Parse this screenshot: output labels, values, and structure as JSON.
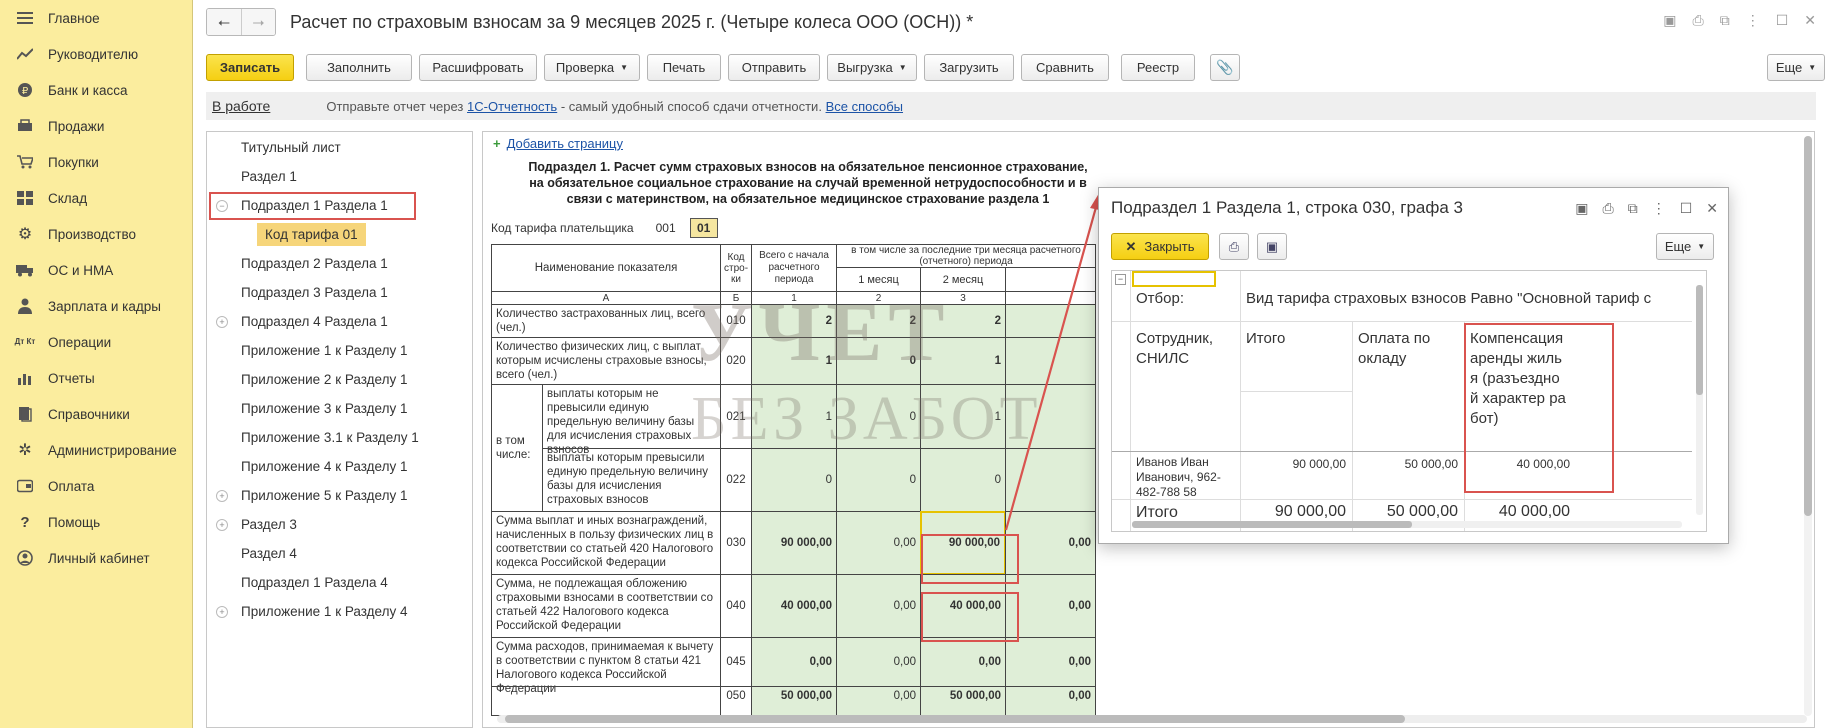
{
  "sidebar": {
    "items": [
      {
        "label": "Главное",
        "icon": "menu-icon"
      },
      {
        "label": "Руководителю",
        "icon": "trend-icon"
      },
      {
        "label": "Банк и касса",
        "icon": "ruble-icon"
      },
      {
        "label": "Продажи",
        "icon": "cart-icon"
      },
      {
        "label": "Покупки",
        "icon": "basket-icon"
      },
      {
        "label": "Склад",
        "icon": "warehouse-icon"
      },
      {
        "label": "Производство",
        "icon": "gear-icon"
      },
      {
        "label": "ОС и НМА",
        "icon": "truck-icon"
      },
      {
        "label": "Зарплата и кадры",
        "icon": "person-icon"
      },
      {
        "label": "Операции",
        "icon": "operations-icon",
        "glyph": "Дт Кт"
      },
      {
        "label": "Отчеты",
        "icon": "chart-icon"
      },
      {
        "label": "Справочники",
        "icon": "book-icon"
      },
      {
        "label": "Администрирование",
        "icon": "settings-icon"
      },
      {
        "label": "Оплата",
        "icon": "payment-icon"
      },
      {
        "label": "Помощь",
        "icon": "help-icon"
      },
      {
        "label": "Личный кабинет",
        "icon": "account-icon"
      }
    ]
  },
  "header": {
    "title": "Расчет по страховым взносам за 9 месяцев 2025 г. (Четыре колеса ООО (ОСН)) *"
  },
  "toolbar": {
    "write": "Записать",
    "fill": "Заполнить",
    "decode": "Расшифровать",
    "check": "Проверка",
    "print": "Печать",
    "send": "Отправить",
    "export": "Выгрузка",
    "load": "Загрузить",
    "compare": "Сравнить",
    "registry": "Реестр",
    "more": "Еще"
  },
  "infobar": {
    "status": "В работе",
    "text_before": "Отправьте отчет через",
    "link1": "1С-Отчетность",
    "text_middle": "- самый удобный способ сдачи отчетности.",
    "link2": "Все способы"
  },
  "tree": {
    "items": [
      {
        "label": "Титульный лист",
        "expander": ""
      },
      {
        "label": "Раздел 1",
        "expander": ""
      },
      {
        "label": "Подраздел 1 Раздела 1",
        "expander": "−"
      },
      {
        "label": "Код тарифа 01",
        "expander": ""
      },
      {
        "label": "Подраздел 2 Раздела 1",
        "expander": ""
      },
      {
        "label": "Подраздел 3 Раздела 1",
        "expander": ""
      },
      {
        "label": "Подраздел 4 Раздела 1",
        "expander": "+"
      },
      {
        "label": "Приложение 1 к Разделу 1",
        "expander": ""
      },
      {
        "label": "Приложение 2 к Разделу 1",
        "expander": ""
      },
      {
        "label": "Приложение 3 к Разделу 1",
        "expander": ""
      },
      {
        "label": "Приложение 3.1 к Разделу 1",
        "expander": ""
      },
      {
        "label": "Приложение 4 к Разделу 1",
        "expander": ""
      },
      {
        "label": "Приложение 5 к Разделу 1",
        "expander": "+"
      },
      {
        "label": "Раздел 3",
        "expander": "+"
      },
      {
        "label": "Раздел 4",
        "expander": ""
      },
      {
        "label": "Подраздел 1 Раздела 4",
        "expander": ""
      },
      {
        "label": "Приложение 1 к Разделу 4",
        "expander": "+"
      }
    ]
  },
  "form": {
    "add_page": "Добавить страницу",
    "title": "Подраздел 1. Расчет сумм страховых взносов на обязательное пенсионное страхование, на обязательное социальное страхование на случай временной нетрудоспособности и в связи с материнством, на обязательное медицинское страхование раздела 1",
    "tarif_label": "Код тарифа плательщика",
    "tarif_code": "001",
    "tarif_value": "01",
    "watermark1": "УЧЕТ",
    "watermark2": "БЕЗ ЗАБОТ",
    "headers": {
      "name": "Наименование показателя",
      "code": "Код стро-ки",
      "total": "Всего с начала расчетного периода",
      "last3": "в том числе за последние три месяца расчетного (отчетного) периода",
      "m1": "1 месяц",
      "m2": "2 месяц",
      "colA": "А",
      "colB": "Б",
      "col1": "1",
      "col2": "2",
      "col3": "3"
    },
    "vtom": "в том числе:",
    "rows": [
      {
        "name": "Количество застрахованных лиц, всего (чел.)",
        "code": "010",
        "v1": "2",
        "v2": "2",
        "v3": "2",
        "v4": ""
      },
      {
        "name": "Количество физических лиц, с выплат которым исчислены страховые взносы, всего (чел.)",
        "code": "020",
        "v1": "1",
        "v2": "0",
        "v3": "1",
        "v4": ""
      },
      {
        "name": "выплаты которым не превысили единую предельную величину базы для исчисления страховых взносов",
        "code": "021",
        "v1": "1",
        "v2": "0",
        "v3": "1",
        "v4": ""
      },
      {
        "name": "выплаты которым превысили единую предельную величину базы для исчисления страховых взносов",
        "code": "022",
        "v1": "0",
        "v2": "0",
        "v3": "0",
        "v4": ""
      },
      {
        "name": "Сумма выплат и иных вознаграждений, начисленных в пользу физических лиц в соответствии со статьей 420 Налогового кодекса Российской Федерации",
        "code": "030",
        "v1": "90 000,00",
        "v2": "0,00",
        "v3": "90 000,00",
        "v4": "0,00"
      },
      {
        "name": "Сумма, не подлежащая обложению страховыми взносами в соответствии со статьей 422 Налогового кодекса Российской  Федерации",
        "code": "040",
        "v1": "40 000,00",
        "v2": "0,00",
        "v3": "40 000,00",
        "v4": "0,00"
      },
      {
        "name": "Сумма расходов, принимаемая к вычету в соответствии с пунктом 8 статьи 421 Налогового кодекса Российской Федерации",
        "code": "045",
        "v1": "0,00",
        "v2": "0,00",
        "v3": "0,00",
        "v4": "0,00"
      },
      {
        "name": "",
        "code": "050",
        "v1": "50 000,00",
        "v2": "0,00",
        "v3": "50 000,00",
        "v4": "0,00"
      }
    ]
  },
  "popup": {
    "title": "Подраздел 1 Раздела 1, строка 030, графа 3",
    "close": "Закрыть",
    "more": "Еще",
    "filter_label": "Отбор:",
    "filter_value": "Вид тарифа страховых взносов Равно \"Основной тариф с",
    "columns": {
      "employee": "Сотрудник, СНИЛС",
      "total": "Итого",
      "salary": "Оплата по окладу",
      "rent": "Компенсация аренды жилья (разъездной характер работ)"
    },
    "row": {
      "employee": "Иванов Иван Иванович, 962-482-788 58",
      "total": "90 000,00",
      "salary": "50 000,00",
      "rent": "40 000,00"
    },
    "totals": {
      "label": "Итого",
      "total": "90 000,00",
      "salary": "50 000,00",
      "rent": "40 000,00"
    }
  }
}
